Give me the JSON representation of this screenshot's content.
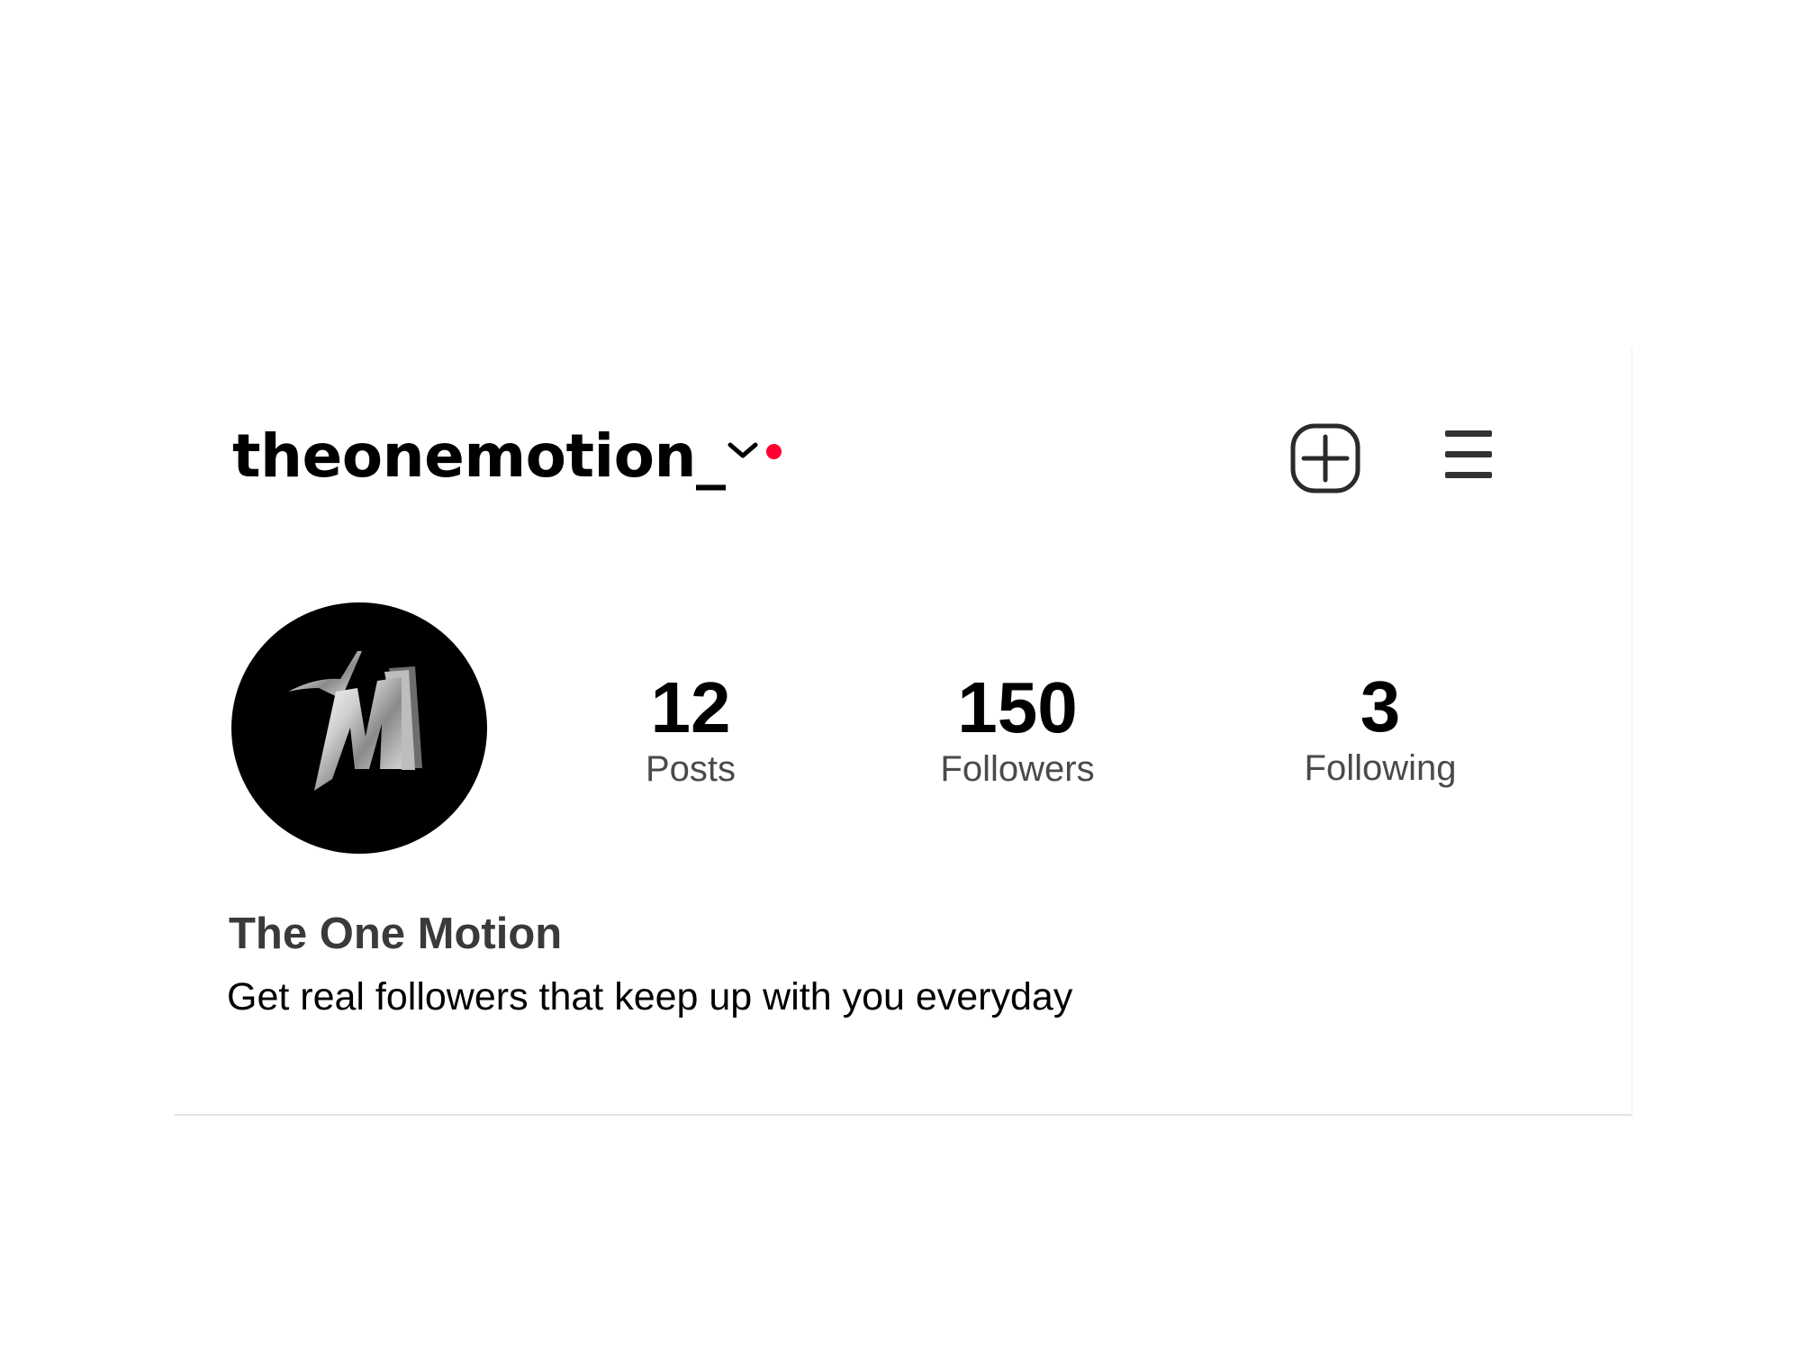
{
  "header": {
    "username": "theonemotion_",
    "account_switcher_icon": "chevron-down-icon",
    "notification_dot_color": "#ff0033",
    "new_post_icon": "add-square-icon",
    "menu_icon": "hamburger-menu-icon"
  },
  "profile": {
    "avatar_icon": "1M-logo",
    "stats": [
      {
        "value": "12",
        "label": "Posts"
      },
      {
        "value": "150",
        "label": "Followers"
      },
      {
        "value": "3",
        "label": "Following"
      }
    ],
    "display_name": "The One Motion",
    "bio": "Get real followers that keep up with you everyday"
  }
}
